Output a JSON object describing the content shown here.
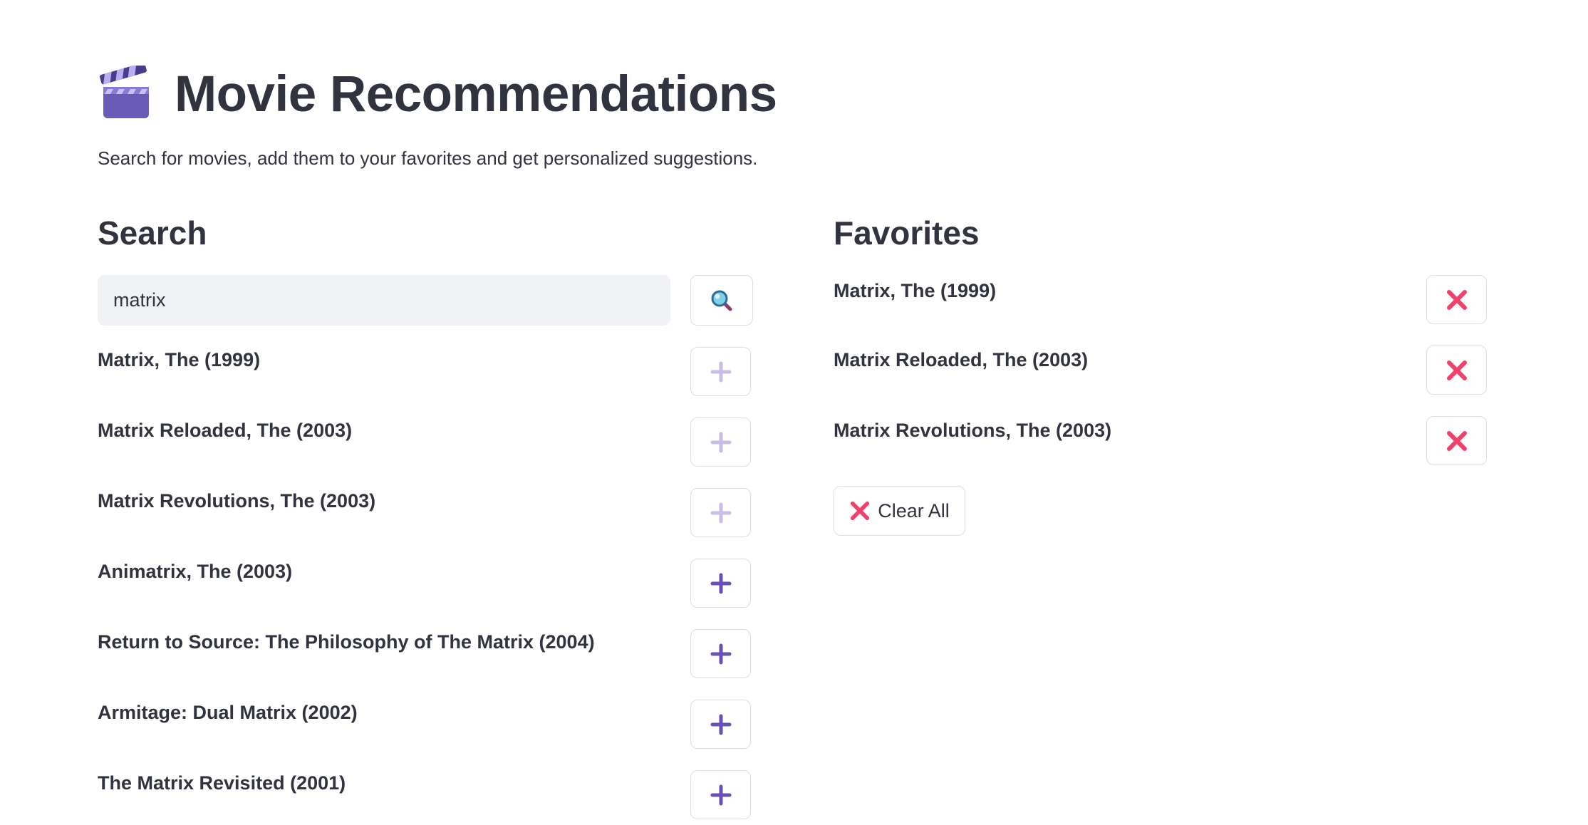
{
  "header": {
    "title": "Movie Recommendations",
    "subtitle": "Search for movies, add them to your favorites and get personalized suggestions."
  },
  "search": {
    "heading": "Search",
    "value": "matrix",
    "results": [
      {
        "title": "Matrix, The (1999)",
        "in_favorites": true
      },
      {
        "title": "Matrix Reloaded, The (2003)",
        "in_favorites": true
      },
      {
        "title": "Matrix Revolutions, The (2003)",
        "in_favorites": true
      },
      {
        "title": "Animatrix, The (2003)",
        "in_favorites": false
      },
      {
        "title": "Return to Source: The Philosophy of The Matrix (2004)",
        "in_favorites": false
      },
      {
        "title": "Armitage: Dual Matrix (2002)",
        "in_favorites": false
      },
      {
        "title": "The Matrix Revisited (2001)",
        "in_favorites": false
      }
    ]
  },
  "favorites": {
    "heading": "Favorites",
    "items": [
      {
        "title": "Matrix, The (1999)"
      },
      {
        "title": "Matrix Reloaded, The (2003)"
      },
      {
        "title": "Matrix Revolutions, The (2003)"
      }
    ],
    "clear_label": "Clear All"
  },
  "icons": {
    "title": "clapperboard-icon",
    "search": "magnifying-glass-icon",
    "add": "plus-icon",
    "remove": "cross-mark-icon"
  },
  "colors": {
    "text": "#31333f",
    "plus_active": "#6a4fb5",
    "plus_disabled": "#c9bde6",
    "cross": "#f0416c",
    "input_bg": "#f0f2f6",
    "button_border": "#dcdee3"
  }
}
